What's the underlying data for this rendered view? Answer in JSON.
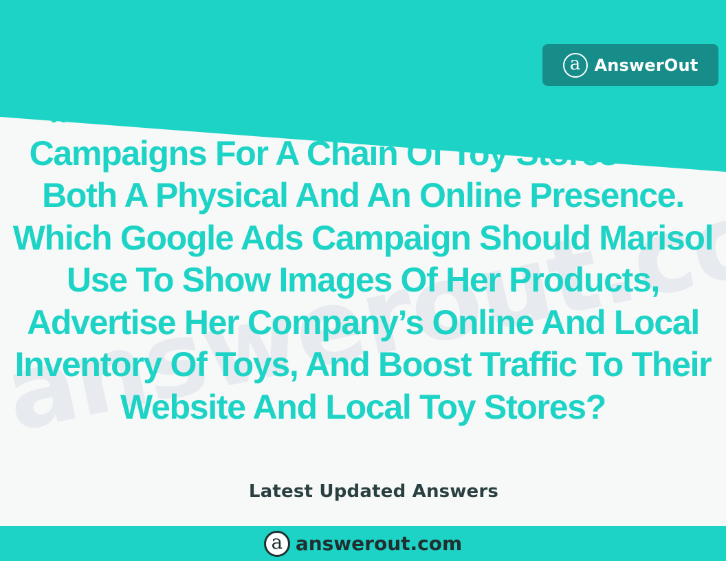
{
  "brand": {
    "logo_letter": "a",
    "name": "AnswerOut"
  },
  "watermark_text": "answerout.com",
  "question": "Marisol Manages The Online Advertising Campaigns For A Chain Of Toy Stores With Both A Physical And An Online Presence. Which Google Ads Campaign Should Marisol Use To Show Images Of Her Products, Advertise Her Company’s Online And Local Inventory Of Toys, And Boost Traffic To Their Website And Local Toy Stores?",
  "subtitle": "Latest Updated Answers",
  "footer": {
    "logo_letter": "a",
    "site": "answerout.com"
  },
  "colors": {
    "accent": "#1dd3c6",
    "badge": "#178d8a",
    "dark_text": "#203030",
    "background": "#f7f8f8"
  }
}
